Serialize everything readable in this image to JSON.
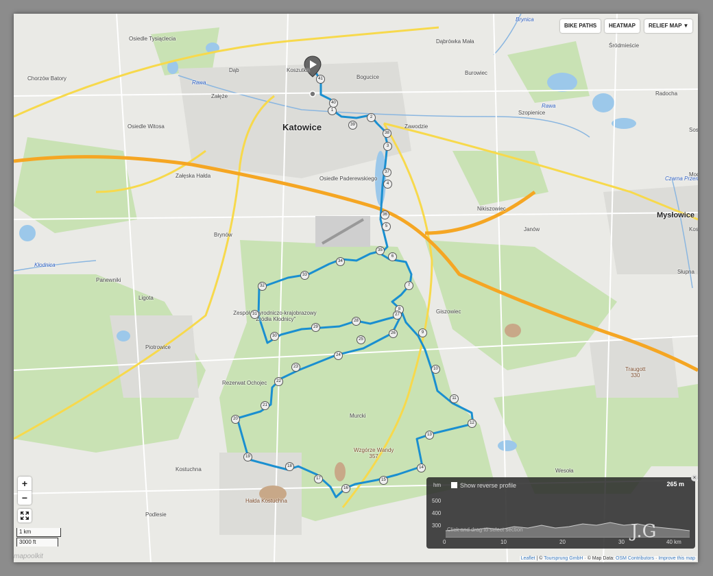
{
  "map": {
    "cities": [
      "Katowice",
      "Mysłowice"
    ],
    "districts": [
      "Osiedle Tysiąclecia",
      "Chorzów Batory",
      "Dąb",
      "Koszutka",
      "Bogucice",
      "Dąbrówka Mała",
      "Śródmieście",
      "Załęże",
      "Osiedle Witosa",
      "Burowiec",
      "Szopienice",
      "Radocha",
      "Zawodzie",
      "Załęska Hałda",
      "Osiedle Paderewskiego",
      "Nikiszowiec",
      "Janów",
      "Brynów",
      "Panewniki",
      "Ligota",
      "Giszowiec",
      "Słupna",
      "Piotrowice",
      "Rezerwat Ochojec",
      "Murcki",
      "Kostuchna",
      "Podlesie",
      "Wesoła",
      "Sosnowiec",
      "Modrzejów",
      "Kosztowy"
    ],
    "nature_labels": [
      "Zespół przyrodniczo-krajobrazowy \"Źródła Kłodnicy\""
    ],
    "peaks": [
      {
        "name": "Wzgórze Wandy",
        "elevation": "357"
      },
      {
        "name": "Traugott",
        "elevation": "330"
      },
      {
        "name": "Hałda Kostuchna",
        "elevation": ""
      }
    ],
    "rivers": [
      "Rawa",
      "Kłodnica",
      "Brynica",
      "Czarna Przemsza"
    ],
    "waypoints": [
      "1",
      "2",
      "3",
      "4",
      "5",
      "6",
      "7",
      "8",
      "9",
      "10",
      "11",
      "12",
      "13",
      "14",
      "15",
      "16",
      "17",
      "18",
      "19",
      "20",
      "21",
      "22",
      "23",
      "24",
      "25",
      "26",
      "27",
      "28",
      "29",
      "30",
      "31",
      "32",
      "33",
      "34",
      "35",
      "36",
      "37",
      "38",
      "39",
      "40",
      "41"
    ]
  },
  "controls": {
    "bike_paths": "BIKE PATHS",
    "heatmap": "HEATMAP",
    "relief_map": "RELIEF MAP ▼",
    "zoom_in": "+",
    "zoom_out": "−"
  },
  "scale": {
    "metric": "1 km",
    "imperial": "3000 ft"
  },
  "elevation_profile": {
    "unit": "hm",
    "show_reverse_label": "Show reverse profile",
    "current_value": "265 m",
    "y_ticks": [
      "500",
      "400",
      "300"
    ],
    "x_ticks": [
      "0",
      "10",
      "20",
      "30"
    ],
    "x_end": "40 km",
    "hint": "Click and drag to select section"
  },
  "attribution": {
    "leaflet": "Leaflet",
    "sep1": " | © ",
    "toursprung": "Toursprung GmbH",
    "mid": " · © Map Data: ",
    "osm": "OSM Contributors",
    "sep2": " · ",
    "improve": "Improve this map"
  },
  "watermark": "mapoolkit",
  "signature": "J.G",
  "colors": {
    "route": "#1a8fd0",
    "motorway": "#f5a623",
    "water": "#9cc8ea",
    "forest": "#c7e0b0"
  }
}
